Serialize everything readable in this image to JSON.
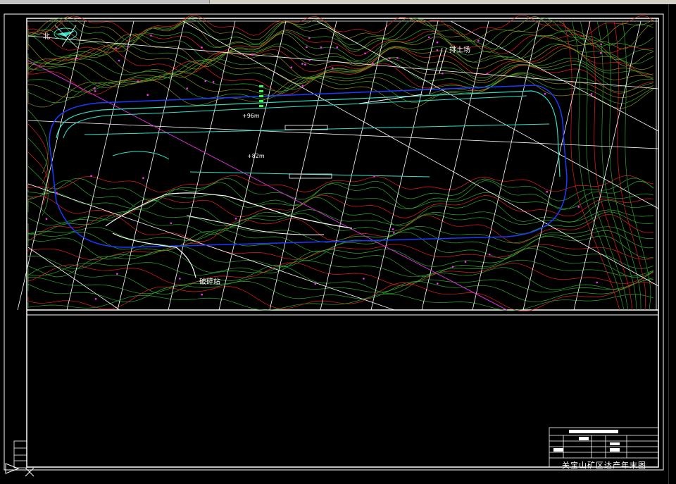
{
  "drawing": {
    "title": "关宝山矿区达产年末图",
    "north_label": "北",
    "labels": {
      "soil_yard": "排土场",
      "crushing_station": "破碎站",
      "elevation_upper": "+96m",
      "elevation_lower": "+82m"
    }
  },
  "colors": {
    "background": "#000000",
    "contour_green": "#2fa52f",
    "contour_red": "#e02020",
    "contour_olive": "#8a8a1a",
    "pit_blue": "#1a3cff",
    "bench_cyan": "#33e0c8",
    "grid_white": "#ffffff",
    "section_magenta": "#d030d0",
    "points_magenta": "#ff33ff"
  }
}
